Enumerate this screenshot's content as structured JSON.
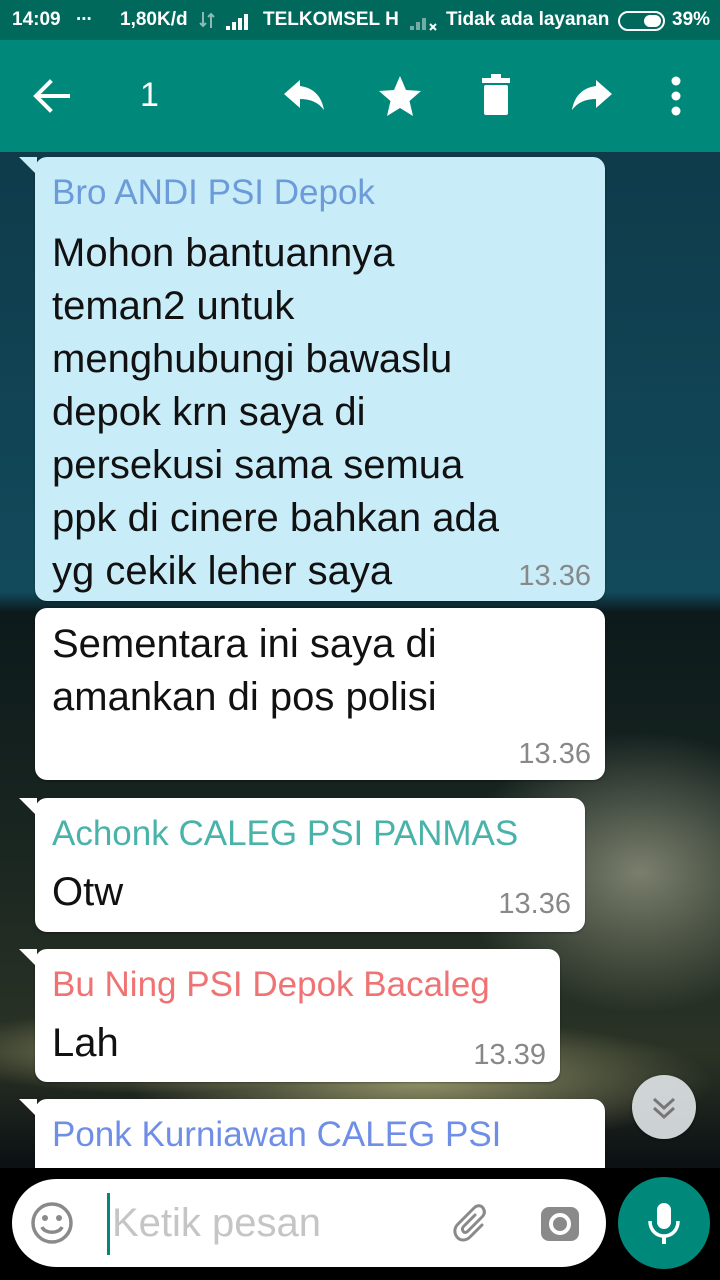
{
  "status_bar": {
    "time": "14:09",
    "dots": "...",
    "speed": "1,80K/d",
    "carrier": "TELKOMSEL H",
    "no_service": "Tidak ada layanan",
    "battery": "39%"
  },
  "action_bar": {
    "selected_count": "1",
    "icons": [
      "back-arrow-icon",
      "reply-icon",
      "star-icon",
      "delete-icon",
      "forward-icon",
      "more-vert-icon"
    ]
  },
  "messages": [
    {
      "sender": "Bro ANDI PSI Depok",
      "text": "Mohon bantuannya\nteman2 untuk\nmenghubungi bawaslu\ndepok krn saya di\npersekusi sama semua\nppk di cinere bahkan ada\nyg cekik leher saya",
      "time": "13.36",
      "selected": true
    },
    {
      "text": "Sementara ini saya di\namankan di pos polisi",
      "time": "13.36"
    },
    {
      "sender": "Achonk CALEG PSI PANMAS",
      "text": "Otw",
      "time": "13.36"
    },
    {
      "sender": "Bu Ning PSI Depok Bacaleg",
      "text": "Lah",
      "time": "13.39"
    },
    {
      "sender": "Ponk Kurniawan CALEG PSI"
    }
  ],
  "colors": {
    "header": "#00897b",
    "status_bar": "#00695c",
    "selected_bubble": "#c9ecf9",
    "sender_andi": "#6b9bd8",
    "sender_achonk": "#4ab3a9",
    "sender_ning": "#ef7373",
    "sender_ponk": "#6f8fe6"
  },
  "composer": {
    "placeholder": "Ketik pesan",
    "icons": [
      "emoji-icon",
      "attach-icon",
      "camera-icon",
      "mic-icon"
    ]
  }
}
